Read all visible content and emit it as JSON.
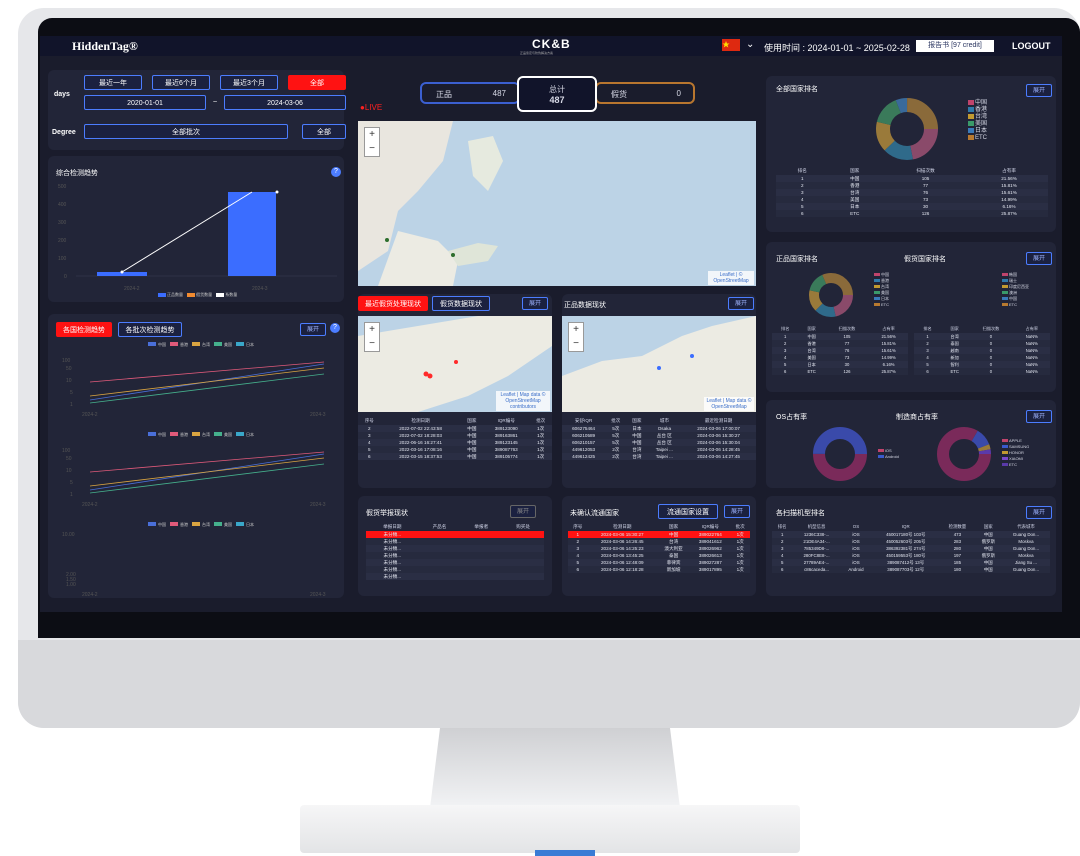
{
  "header": {
    "logo": "HiddenTag®",
    "center_logo": "CK&B",
    "center_sub": "正品鉴定与防伪解决方案",
    "usage_label": "使用时间 : 2024-01-01 ~ 2025-02-28",
    "report_button": "报告书 [97 credit]",
    "logout": "LOGOUT"
  },
  "filters": {
    "days_label": "days",
    "day_buttons": [
      "最近一年",
      "最近6个月",
      "最近3个月",
      "全部"
    ],
    "date_from": "2020-01-01",
    "date_sep": "~",
    "date_to": "2024-03-06",
    "degree_label": "Degree",
    "degree_value": "全部批次",
    "degree_all": "全部"
  },
  "trend": {
    "title": "综合检测趋势",
    "help": "?",
    "legend": [
      "正品数量",
      "假货数量",
      "系数量"
    ]
  },
  "country_trend": {
    "tabs": [
      "各国检测趋势",
      "各批次检测趋势"
    ],
    "open": "展开",
    "legend": [
      "中国",
      "香港",
      "台湾",
      "美国",
      "日本"
    ]
  },
  "counters": {
    "genuine_label": "正品",
    "genuine_value": "487",
    "total_label": "总计",
    "total_value": "487",
    "fake_label": "假货",
    "fake_value": "0",
    "live": "LIVE"
  },
  "map_main": {
    "attribution": "Leaflet | © OpenStreetMap"
  },
  "recent": {
    "tabs": [
      "最近假货处理现状",
      "假货数据现状"
    ],
    "open": "展开",
    "attribution": "Leaflet | Map data © OpenStreetMap contributors",
    "headers": [
      "序号",
      "检测日期",
      "国家",
      "IQR编号",
      "批次"
    ],
    "rows": [
      [
        "2",
        "2022-07-02 22:43:58",
        "中国",
        "389123090",
        "1次"
      ],
      [
        "3",
        "2022-07-02 18:28:03",
        "中国",
        "389163861",
        "1次"
      ],
      [
        "4",
        "2022-06-16 16:27:41",
        "中国",
        "389123145",
        "1次"
      ],
      [
        "5",
        "2022-03-16 17:08:16",
        "中国",
        "389087763",
        "1次"
      ],
      [
        "6",
        "2022-03-15 18:37:53",
        "中国",
        "389105774",
        "1次"
      ]
    ]
  },
  "genuine_data": {
    "title": "正品数据现状",
    "open": "展开",
    "attribution": "Leaflet | Map data © OpenStreetMap",
    "headers": [
      "安舒IQR",
      "批次",
      "国家",
      "城市",
      "最近检测日期"
    ],
    "rows": [
      [
        "606275464",
        "5次",
        "日本",
        "Osaka",
        "2024-03-06 17:00:07"
      ],
      [
        "606210589",
        "5次",
        "中国",
        "丛台 区",
        "2024-03-06 15:30:27"
      ],
      [
        "606210157",
        "5次",
        "中国",
        "丛台 区",
        "2024-03-06 15:30:04"
      ],
      [
        "449612053",
        "2次",
        "台湾",
        "Taipei ...",
        "2024-03-06 14:28:45"
      ],
      [
        "449612425",
        "2次",
        "台湾",
        "Taipei ...",
        "2024-03-06 14:27:45"
      ]
    ]
  },
  "fake_report": {
    "title": "假货举报现状",
    "open": "展开",
    "headers": [
      "举报日期",
      "产品名",
      "举报者",
      "购买处"
    ],
    "rows": [
      [
        "未分類...",
        "",
        "",
        ""
      ],
      [
        "未分類...",
        "",
        "",
        ""
      ],
      [
        "未分類...",
        "",
        "",
        ""
      ],
      [
        "未分類...",
        "",
        "",
        ""
      ],
      [
        "未分類...",
        "",
        "",
        ""
      ],
      [
        "未分類...",
        "",
        "",
        ""
      ],
      [
        "未分類...",
        "",
        "",
        ""
      ]
    ]
  },
  "unapproved": {
    "title": "未确认流通国家",
    "setting": "流通国家设置",
    "open": "展开",
    "headers": [
      "序号",
      "检测日期",
      "国家",
      "IQR编号",
      "批次"
    ],
    "rows": [
      [
        "1",
        "2024-03-06 15:30:27",
        "中国",
        "389022764",
        "1次"
      ],
      [
        "2",
        "2024-03-06 14:26:45",
        "台湾",
        "389041612",
        "1次"
      ],
      [
        "3",
        "2024-03-06 14:25:23",
        "澳大利亚",
        "389026962",
        "1次"
      ],
      [
        "4",
        "2024-03-06 13:45:25",
        "泰国",
        "389026613",
        "1次"
      ],
      [
        "5",
        "2024-03-06 12:48:09",
        "菲律宾",
        "389027287",
        "1次"
      ],
      [
        "6",
        "2024-03-06 12:18:28",
        "新加坡",
        "389017895",
        "1次"
      ]
    ]
  },
  "country_rank": {
    "title": "全部国家排名",
    "open": "展开",
    "legend": [
      "中国",
      "香港",
      "台湾",
      "美国",
      "日本",
      "ETC"
    ],
    "headers": [
      "排名",
      "国家",
      "扫描次数",
      "占有率"
    ],
    "rows": [
      [
        "1",
        "中国",
        "105",
        "21.56%"
      ],
      [
        "2",
        "香港",
        "77",
        "15.81%"
      ],
      [
        "3",
        "台湾",
        "76",
        "15.61%"
      ],
      [
        "4",
        "美国",
        "73",
        "14.99%"
      ],
      [
        "5",
        "日本",
        "30",
        "6.16%"
      ],
      [
        "6",
        "ETC",
        "126",
        "25.87%"
      ]
    ]
  },
  "genuine_rank": {
    "title": "正品国家排名",
    "fake_title": "假货国家排名",
    "open": "展开",
    "legend_a": [
      "中国",
      "香港",
      "台湾",
      "美国",
      "日本",
      "ETC"
    ],
    "legend_b": [
      "韩国",
      "瑞士",
      "印度尼西亚",
      "澳洲",
      "中国",
      "ETC"
    ],
    "headers": [
      "排名",
      "国家",
      "扫描次数",
      "占有率"
    ],
    "rows_a": [
      [
        "1",
        "中国",
        "105",
        "21.56%"
      ],
      [
        "2",
        "香港",
        "77",
        "15.81%"
      ],
      [
        "3",
        "台湾",
        "76",
        "15.61%"
      ],
      [
        "4",
        "美国",
        "73",
        "14.99%"
      ],
      [
        "5",
        "日本",
        "30",
        "6.16%"
      ],
      [
        "6",
        "ETC",
        "126",
        "25.87%"
      ]
    ],
    "rows_b": [
      [
        "1",
        "台湾",
        "0",
        "NaN%"
      ],
      [
        "2",
        "泰国",
        "0",
        "NaN%"
      ],
      [
        "3",
        "越南",
        "0",
        "NaN%"
      ],
      [
        "4",
        "新加",
        "0",
        "NaN%"
      ],
      [
        "5",
        "智利",
        "0",
        "NaN%"
      ],
      [
        "6",
        "ETC",
        "0",
        "NaN%"
      ]
    ]
  },
  "os_share": {
    "title": "OS占有率",
    "maker_title": "制造商占有率",
    "open": "展开",
    "os_legend": [
      "iOS",
      "Android"
    ],
    "maker_legend": [
      "APPLE",
      "SAMSUNG",
      "HONOR",
      "XIAOMI",
      "ETC"
    ]
  },
  "device_rank": {
    "title": "各扫描机型排名",
    "open": "展开",
    "headers": [
      "排名",
      "机型信息",
      "OS",
      "IQR",
      "检测数量",
      "国家",
      "代表城市"
    ],
    "rows": [
      [
        "1",
        "1236C338-...",
        "iOS",
        "450017180号 103号",
        "473",
        "中国",
        "Guang Don..."
      ],
      [
        "2",
        "21DE4A34-...",
        "iOS",
        "450052603号 205号",
        "283",
        "俄罗斯",
        "Moskva"
      ],
      [
        "3",
        "785349D8-...",
        "iOS",
        "386392381号 274号",
        "280",
        "中国",
        "Guang Don..."
      ],
      [
        "4",
        "280FC8E8-...",
        "iOS",
        "450159553号 180号",
        "197",
        "俄罗斯",
        "Moskva"
      ],
      [
        "5",
        "27789AE4-...",
        "iOS",
        "389087412号 13号",
        "185",
        "中国",
        "Jiang Su ..."
      ],
      [
        "6",
        "c86caceda...",
        "Android",
        "389087703号 12号",
        "180",
        "中国",
        "Guang Don..."
      ]
    ]
  }
}
